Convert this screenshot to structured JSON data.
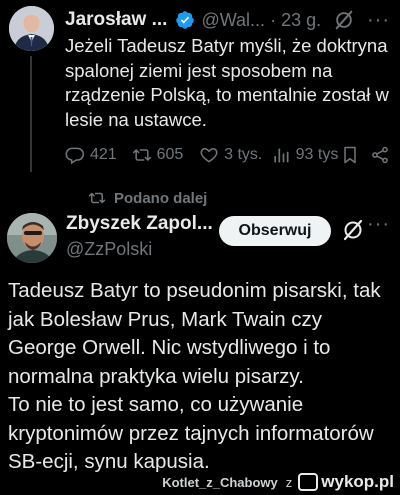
{
  "original_tweet": {
    "author_name": "Jarosław ...",
    "handle": "@Wal...",
    "separator": "·",
    "time": "23 g.",
    "more": "···",
    "text": "Jeżeli Tadeusz Batyr myśli, że doktryna spalonej ziemi jest sposobem na rządzenie Polską, to mentalnie został w lesie na ustawce.",
    "stats": {
      "replies": "421",
      "reposts": "605",
      "likes": "3 tys.",
      "views": "93 tys"
    }
  },
  "repost_label": "Podano dalej",
  "reply_tweet": {
    "author_name": "Zbyszek Zapol...",
    "handle": "@ZzPolski",
    "follow_label": "Obserwuj",
    "more": "···",
    "text": "Tadeusz Batyr to pseudonim pisarski, tak jak Bolesław Prus, Mark Twain czy George Orwell. Nic wstydliwego i to normalna praktyka wielu pisarzy.\nTo nie to jest samo, co używanie kryptonimów przez tajnych informatorów SB-ecji, synu kapusia."
  },
  "footer": {
    "username": "Kotlet_z_Chabowy",
    "via": "z",
    "site": "wykop.pl"
  },
  "colors": {
    "background": "#000000",
    "text": "#e7e9ea",
    "secondary": "#71767b",
    "verified": "#1d9bf0"
  }
}
